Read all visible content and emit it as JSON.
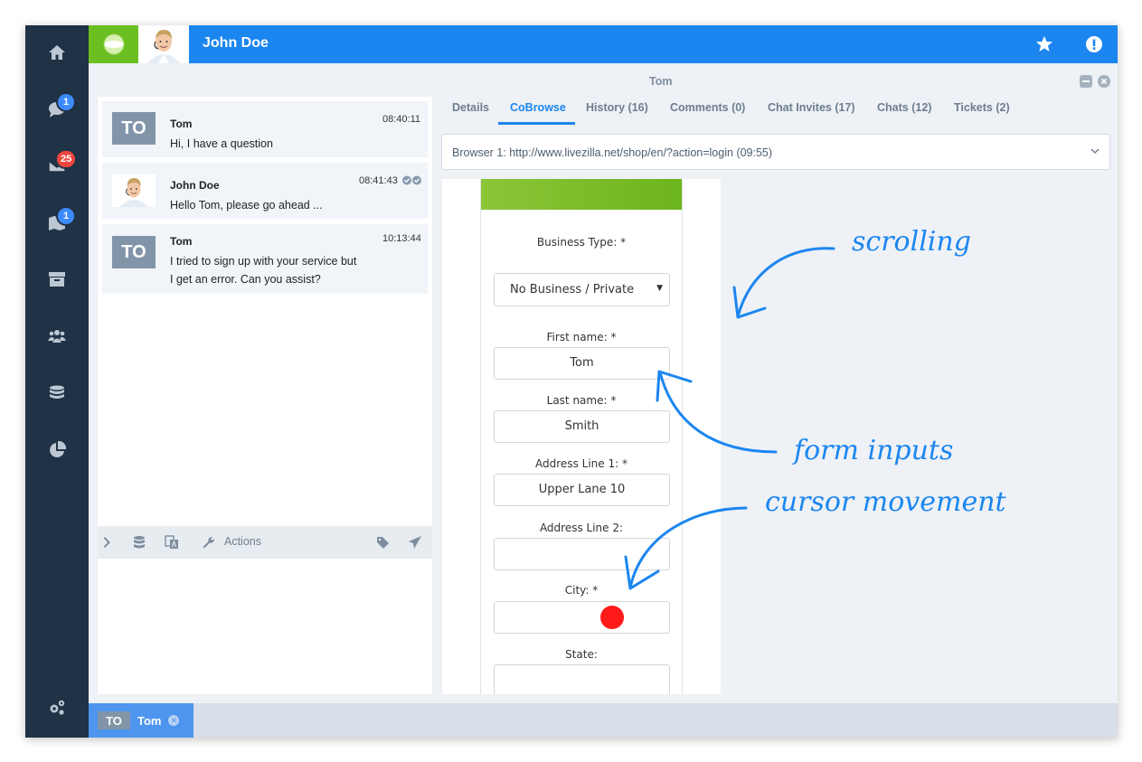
{
  "header": {
    "user_name": "John Doe"
  },
  "sidebar": {
    "items": [
      {
        "icon": "home-icon",
        "badge": null
      },
      {
        "icon": "chats-icon",
        "badge": "1",
        "badge_color": "#3e8bff"
      },
      {
        "icon": "mail-icon",
        "badge": "25",
        "badge_color": "#f0443e"
      },
      {
        "icon": "map-icon",
        "badge": "1",
        "badge_color": "#3e8bff"
      },
      {
        "icon": "archive-icon",
        "badge": null
      },
      {
        "icon": "users-icon",
        "badge": null
      },
      {
        "icon": "database-icon",
        "badge": null
      },
      {
        "icon": "chart-icon",
        "badge": null
      },
      {
        "icon": "settings-icon",
        "badge": null
      }
    ]
  },
  "chat": {
    "messages": [
      {
        "avatar": "TO",
        "sender": "Tom",
        "time": "08:40:11",
        "text": [
          "Hi, I have a question"
        ]
      },
      {
        "avatar": "photo",
        "sender": "John Doe",
        "time": "08:41:43",
        "text": [
          "Hello Tom, please go ahead ..."
        ]
      },
      {
        "avatar": "TO",
        "sender": "Tom",
        "time": "10:13:44",
        "text": [
          "I tried to sign up with your service but",
          "I get an error. Can you assist?"
        ]
      }
    ],
    "toolbar": {
      "actions_label": "Actions"
    }
  },
  "panel": {
    "title": "Tom",
    "tabs": [
      {
        "label": "Details",
        "active": false
      },
      {
        "label": "CoBrowse",
        "active": true
      },
      {
        "label": "History (16)",
        "active": false
      },
      {
        "label": "Comments (0)",
        "active": false
      },
      {
        "label": "Chat Invites (17)",
        "active": false
      },
      {
        "label": "Chats (12)",
        "active": false
      },
      {
        "label": "Tickets (2)",
        "active": false
      }
    ],
    "browser_select": "Browser 1: http://www.livezilla.net/shop/en/?action=login (09:55)"
  },
  "cobrowse": {
    "business_type_label": "Business Type: *",
    "business_type_value": "No Business / Private",
    "first_name_label": "First name: *",
    "first_name_value": "Tom",
    "last_name_label": "Last name: *",
    "last_name_value": "Smith",
    "address1_label": "Address Line 1: *",
    "address1_value": "Upper Lane 10",
    "address2_label": "Address Line 2:",
    "address2_value": "",
    "city_label": "City: *",
    "city_value": "",
    "state_label": "State:",
    "state_value": "",
    "cursor_color": "#ff1a1a"
  },
  "annotations": {
    "scrolling": "scrolling",
    "form_inputs": "form inputs",
    "cursor_movement": "cursor movement"
  },
  "bottom_tab": {
    "avatar": "TO",
    "name": "Tom"
  },
  "colors": {
    "sidebar": "#1f3246",
    "header": "#1b86f0",
    "logo": "#6cbf20",
    "accent": "#1b86f0"
  }
}
